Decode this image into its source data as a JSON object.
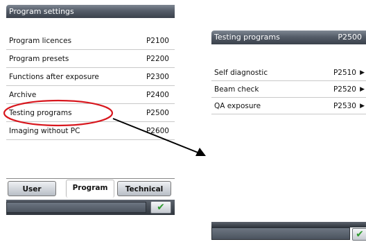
{
  "left_panel": {
    "title": "Program settings",
    "items": [
      {
        "label": "Program licences",
        "code": "P2100"
      },
      {
        "label": "Program presets",
        "code": "P2200"
      },
      {
        "label": "Functions after exposure",
        "code": "P2300"
      },
      {
        "label": "Archive",
        "code": "P2400"
      },
      {
        "label": "Testing programs",
        "code": "P2500"
      },
      {
        "label": "Imaging without PC",
        "code": "P2600"
      }
    ],
    "tabs": [
      {
        "label": "User",
        "active": false
      },
      {
        "label": "Program",
        "active": true
      },
      {
        "label": "Technical",
        "active": false
      }
    ],
    "ok_icon": "checkmark-icon"
  },
  "right_panel": {
    "title": "Testing programs",
    "code": "P2500",
    "items": [
      {
        "label": "Self diagnostic",
        "code": "P2510",
        "icon": "play-arrow-icon"
      },
      {
        "label": "Beam check",
        "code": "P2520",
        "icon": "play-arrow-icon"
      },
      {
        "label": "QA exposure",
        "code": "P2530",
        "icon": "play-arrow-icon"
      }
    ],
    "ok_icon": "checkmark-icon"
  },
  "colors": {
    "highlight_ellipse": "#d8171e",
    "arrow": "#000000",
    "ok_check": "#2e9a2e",
    "titlebar": "#4a515c"
  }
}
